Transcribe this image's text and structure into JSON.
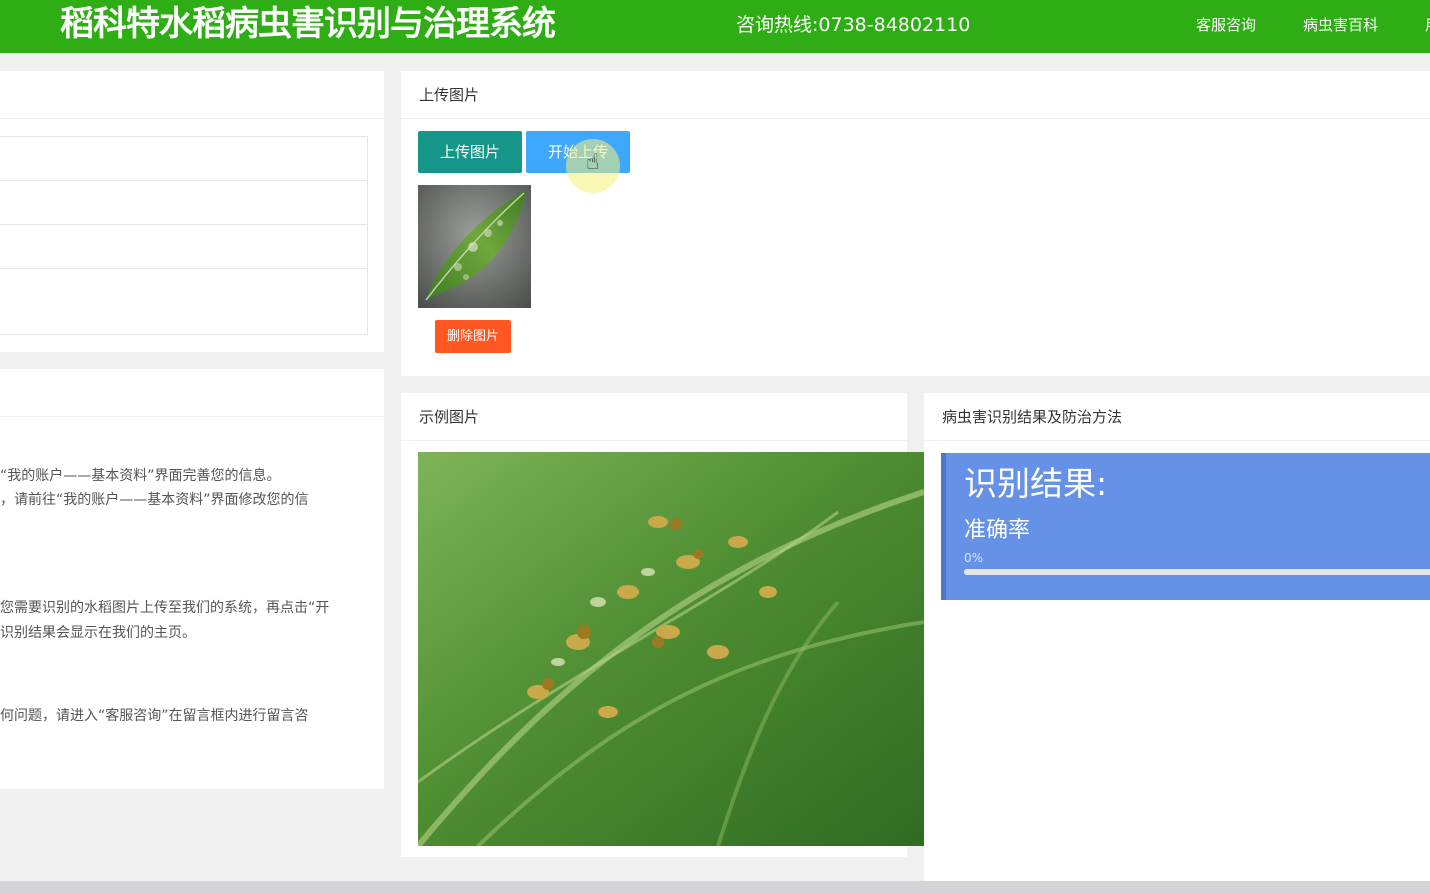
{
  "header": {
    "title": "稻科特水稻病虫害识别与治理系统",
    "hotline": "咨询热线:0738-84802110",
    "nav": [
      "客服咨询",
      "病虫害百科",
      "用"
    ]
  },
  "left_bottom": {
    "lines": [
      "“我的账户——基本资料”界面完善您的信息。",
      "，请前往“我的账户——基本资料”界面修改您的信",
      "您需要识别的水稻图片上传至我们的系统，再点击“开",
      "识别结果会显示在我们的主页。",
      "何问题，请进入“客服咨询”在留言框内进行留言咨"
    ]
  },
  "upload": {
    "heading": "上传图片",
    "upload_button": "上传图片",
    "start_button": "开始上传",
    "delete_button": "删除图片"
  },
  "sample": {
    "heading": "示例图片"
  },
  "result": {
    "heading": "病虫害识别结果及防治方法",
    "title": "识别结果:",
    "accuracy_label": "准确率",
    "accuracy_text": "0%",
    "accuracy_value": 0
  },
  "colors": {
    "header": "#2fad14",
    "teal": "#169689",
    "blue": "#3ea8ff",
    "red": "#ff5722",
    "result": "#6591e6"
  }
}
